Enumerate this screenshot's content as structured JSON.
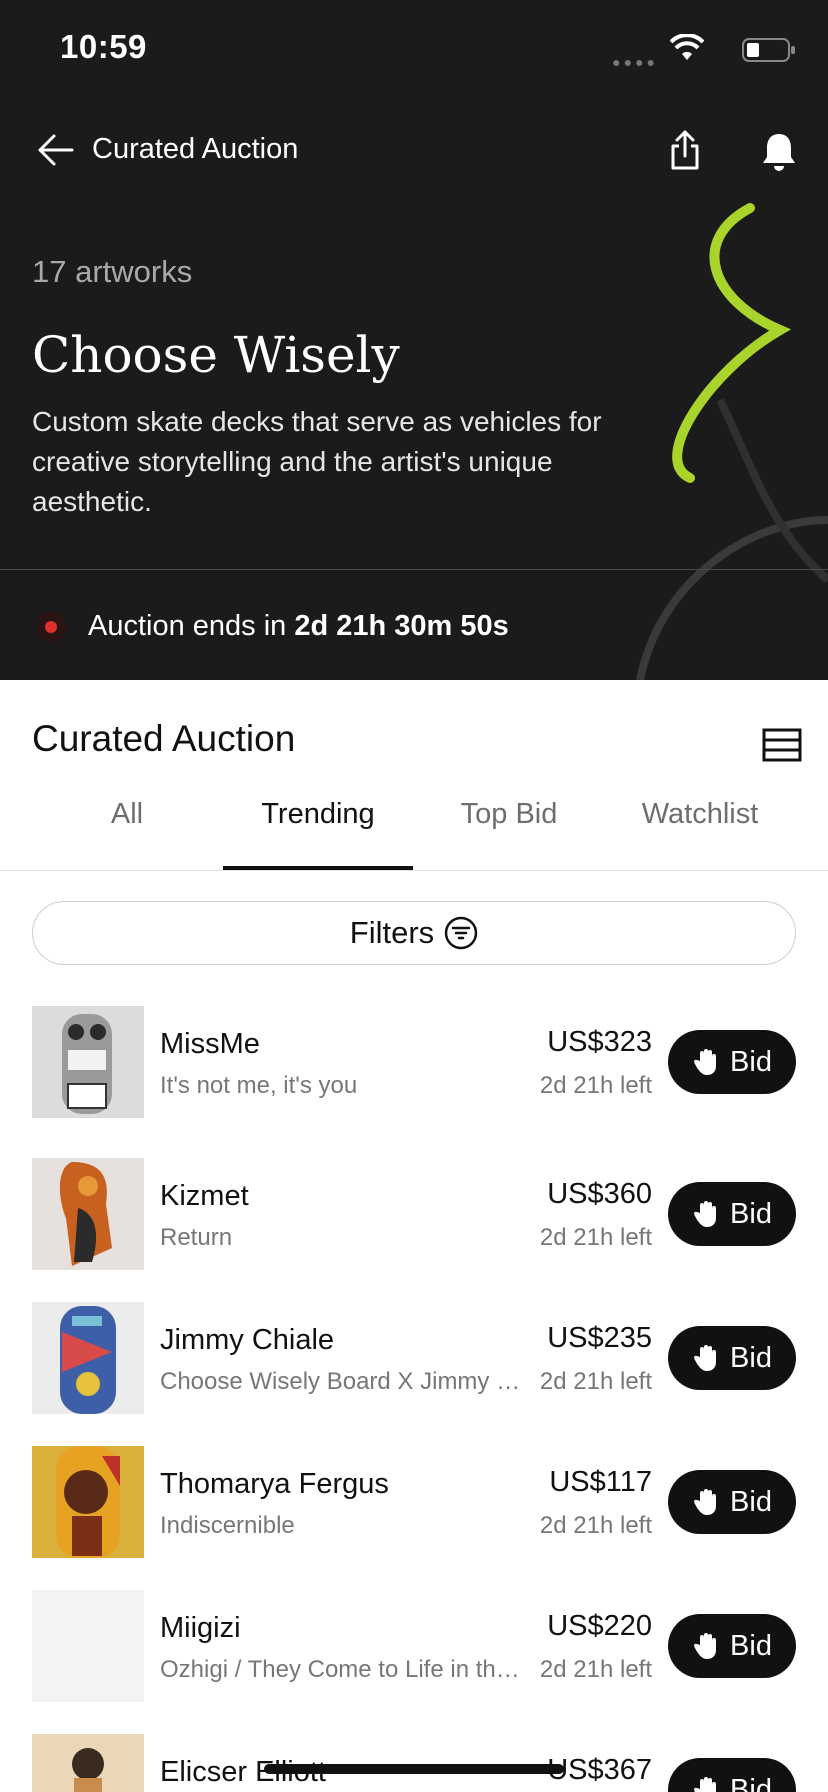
{
  "status_bar": {
    "time": "10:59"
  },
  "nav": {
    "title": "Curated Auction"
  },
  "hero": {
    "artwork_count": "17 artworks",
    "title": "Choose Wisely",
    "description": "Custom skate decks that serve as vehicles for creative storytelling and the artist's unique aesthetic.",
    "auction_prefix": "Auction ends in ",
    "auction_countdown": "2d 21h 30m 50s"
  },
  "section": {
    "title": "Curated Auction"
  },
  "tabs": [
    {
      "label": "All",
      "active": false
    },
    {
      "label": "Trending",
      "active": true
    },
    {
      "label": "Top Bid",
      "active": false
    },
    {
      "label": "Watchlist",
      "active": false
    }
  ],
  "filters": {
    "label": "Filters"
  },
  "lots": [
    {
      "artist": "MissMe",
      "work": "It's not me, it's you",
      "price": "US$323",
      "time_left": "2d 21h left",
      "bid_label": "Bid"
    },
    {
      "artist": "Kizmet",
      "work": "Return",
      "price": "US$360",
      "time_left": "2d 21h left",
      "bid_label": "Bid"
    },
    {
      "artist": "Jimmy Chiale",
      "work": "Choose Wisely Board X Jimmy Chiale",
      "price": "US$235",
      "time_left": "2d 21h left",
      "bid_label": "Bid"
    },
    {
      "artist": "Thomarya Fergus",
      "work": "Indiscernible",
      "price": "US$117",
      "time_left": "2d 21h left",
      "bid_label": "Bid"
    },
    {
      "artist": "Miigizi",
      "work": "Ozhigi / They Come to Life in the Spring",
      "price": "US$220",
      "time_left": "2d 21h left",
      "bid_label": "Bid"
    },
    {
      "artist": "Elicser Elliott",
      "work": "",
      "price": "US$367",
      "time_left": "",
      "bid_label": "Bid"
    }
  ],
  "colors": {
    "accent_green": "#a8d42b",
    "live_red": "#e0302e",
    "dark_bg": "#1b1b1b"
  }
}
